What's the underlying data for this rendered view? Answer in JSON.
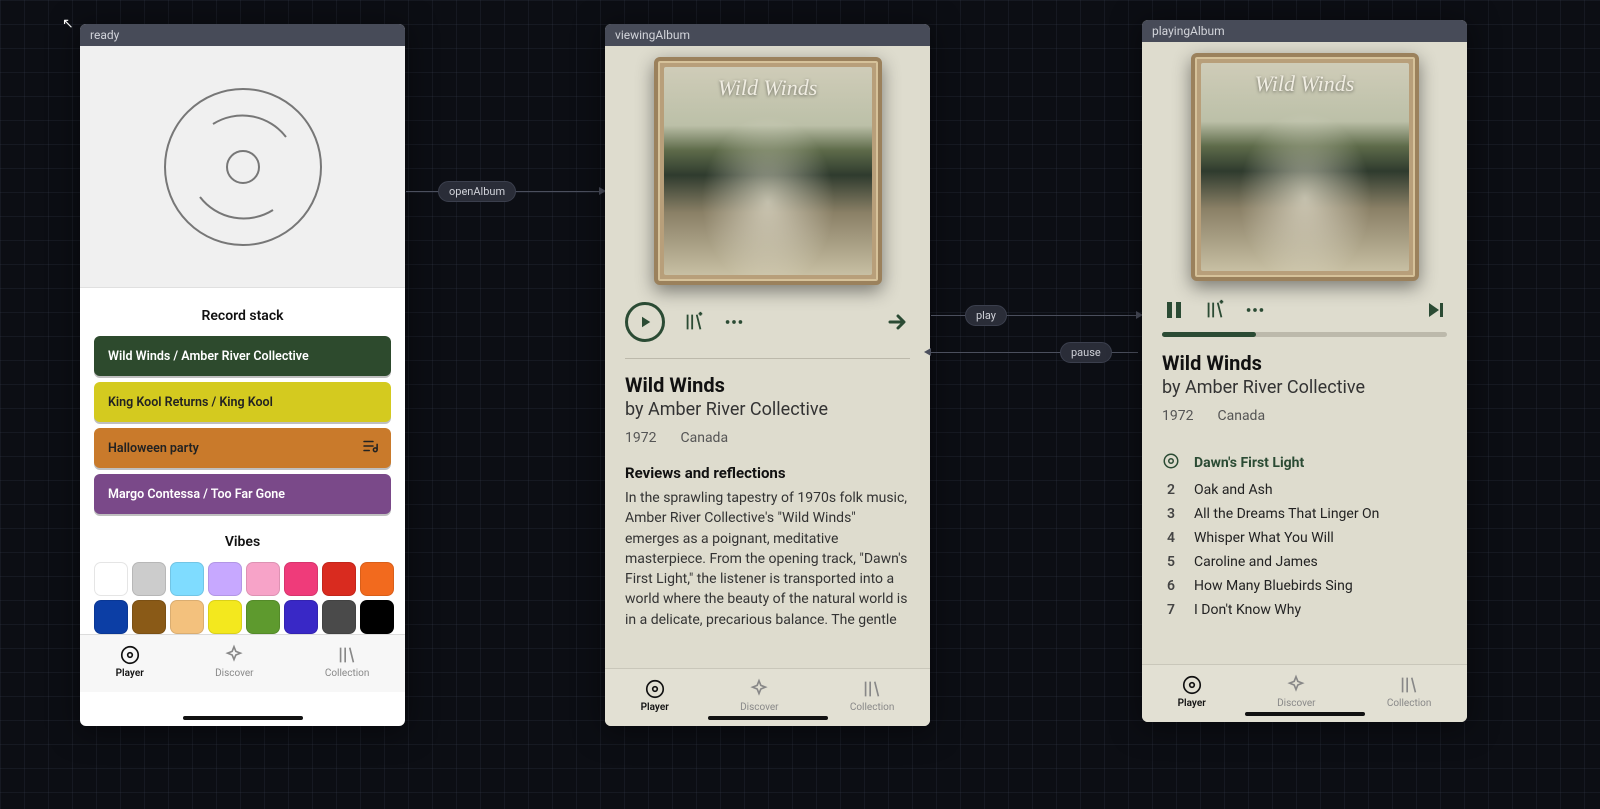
{
  "states": {
    "ready": "ready",
    "viewingAlbum": "viewingAlbum",
    "playingAlbum": "playingAlbum"
  },
  "edges": {
    "openAlbum": "openAlbum",
    "play": "play",
    "pause": "pause"
  },
  "album": {
    "cover_title": "Wild Winds",
    "title": "Wild Winds",
    "by_prefix": "by ",
    "artist": "Amber River Collective",
    "year": "1972",
    "country": "Canada"
  },
  "ready_screen": {
    "record_stack_heading": "Record stack",
    "vibes_heading": "Vibes",
    "stack": [
      {
        "label": "Wild Winds  /  Amber River Collective",
        "color": "green"
      },
      {
        "label": "King Kool Returns  /  King Kool",
        "color": "yellow"
      },
      {
        "label": "Halloween party",
        "color": "orange",
        "is_playlist": true
      },
      {
        "label": "Margo Contessa  /  Too Far Gone",
        "color": "purple"
      }
    ],
    "vibes": [
      "#ffffff",
      "#cccccc",
      "#7fdcff",
      "#c7a8ff",
      "#f7a3c8",
      "#ef3b7a",
      "#d92b1f",
      "#f26a1e",
      "#0c3ea5",
      "#8a5a17",
      "#f3c17d",
      "#f3e81e",
      "#5e9a2e",
      "#3928c6",
      "#4a4a4a",
      "#000000"
    ]
  },
  "viewing_screen": {
    "reviews_heading": "Reviews and reflections",
    "review_body": "In the sprawling tapestry of 1970s folk music, Amber River Collective's \"Wild Winds\" emerges as a poignant, meditative masterpiece. From the opening track, \"Dawn's First Light,\" the listener is transported into a world where the beauty of the natural world is in a delicate, precarious balance. The gentle"
  },
  "playing_screen": {
    "progress_pct": 33,
    "tracks": [
      {
        "n": "",
        "title": "Dawn's First Light",
        "playing": true
      },
      {
        "n": "2",
        "title": "Oak and Ash"
      },
      {
        "n": "3",
        "title": "All the Dreams That Linger On"
      },
      {
        "n": "4",
        "title": "Whisper What You Will"
      },
      {
        "n": "5",
        "title": "Caroline and James"
      },
      {
        "n": "6",
        "title": "How Many Bluebirds Sing"
      },
      {
        "n": "7",
        "title": "I Don't Know Why"
      }
    ]
  },
  "tabs": {
    "player": "Player",
    "discover": "Discover",
    "collection": "Collection"
  }
}
